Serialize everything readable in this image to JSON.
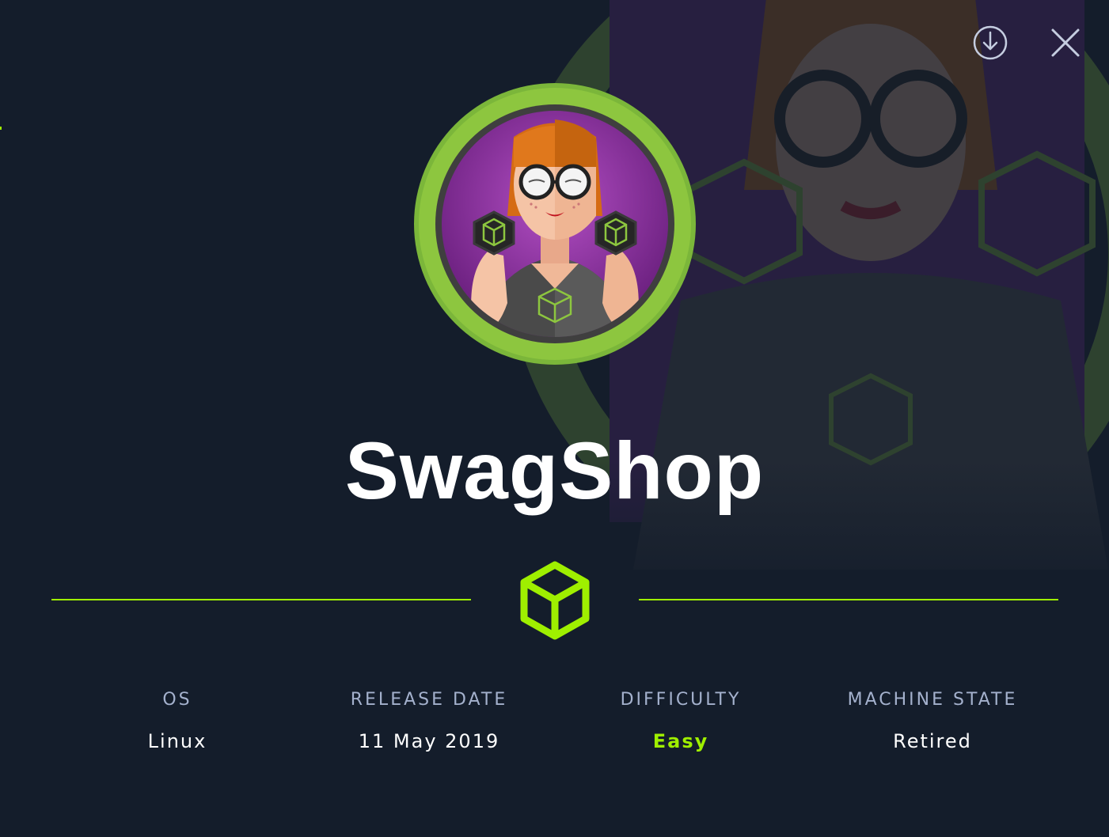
{
  "machine": {
    "name": "SwagShop"
  },
  "toolbar": {
    "download_icon": "download-circle-icon",
    "close_icon": "close-icon"
  },
  "stats": [
    {
      "label": "OS",
      "value": "Linux"
    },
    {
      "label": "RELEASE DATE",
      "value": "11 May 2019"
    },
    {
      "label": "DIFFICULTY",
      "value": "Easy"
    },
    {
      "label": "MACHINE STATE",
      "value": "Retired"
    }
  ],
  "colors": {
    "background": "#141d2b",
    "accent": "#9fef00",
    "label": "#a4b1cd",
    "avatar_ring": "#8dc63f",
    "avatar_inner": "#7a2a8c"
  }
}
